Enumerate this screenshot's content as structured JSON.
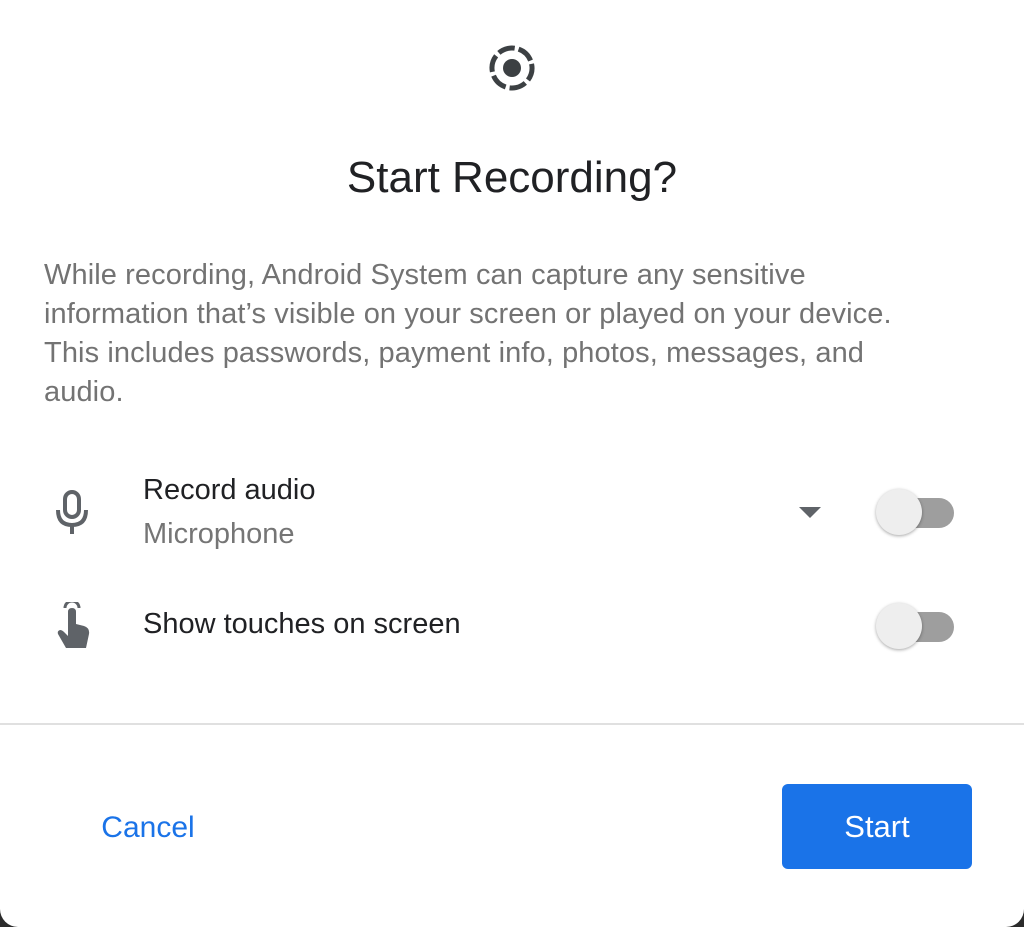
{
  "dialog": {
    "header_icon": "screen-record-icon",
    "title": "Start Recording?",
    "description": "While recording, Android System can capture any sensitive information that’s visible on your screen or played on your device. This includes passwords, payment info, photos, messages, and audio."
  },
  "options": {
    "record_audio": {
      "icon": "microphone-icon",
      "title": "Record audio",
      "subtitle": "Microphone",
      "dropdown_icon": "dropdown-arrow-icon",
      "enabled": false
    },
    "show_touches": {
      "icon": "touch-icon",
      "title": "Show touches on screen",
      "enabled": false
    }
  },
  "buttons": {
    "cancel_label": "Cancel",
    "start_label": "Start"
  },
  "colors": {
    "accent": "#1a73e8",
    "title_text": "#202124",
    "body_text": "#737373",
    "switch_track_off": "#9e9e9e",
    "switch_thumb_off": "#eeeeee"
  }
}
